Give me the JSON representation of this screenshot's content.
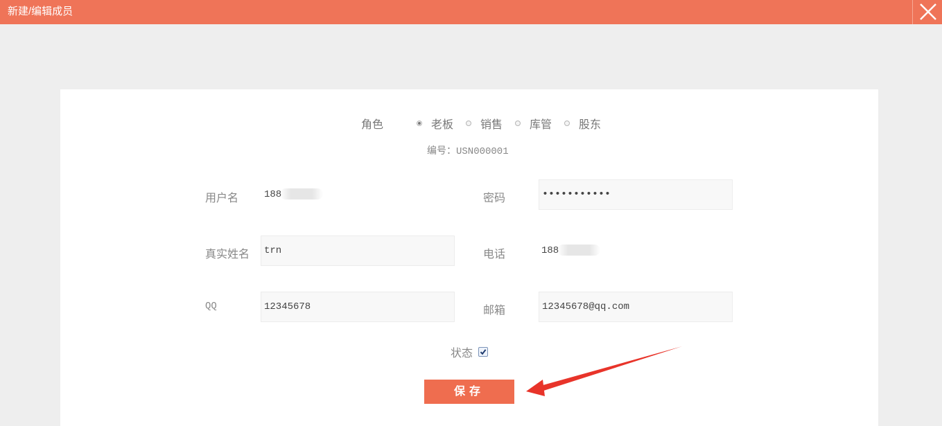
{
  "window": {
    "title": "新建/编辑成员",
    "close_icon": "close-icon"
  },
  "form": {
    "role": {
      "label": "角色",
      "options": [
        {
          "label": "老板",
          "checked": true
        },
        {
          "label": "销售",
          "checked": false
        },
        {
          "label": "库管",
          "checked": false
        },
        {
          "label": "股东",
          "checked": false
        }
      ]
    },
    "code": {
      "label": "编号：",
      "value": "USN000001"
    },
    "username": {
      "label": "用户名",
      "value": "188"
    },
    "password": {
      "label": "密码",
      "value": "•••••••••••"
    },
    "realname": {
      "label": "真实姓名",
      "value": "trn"
    },
    "phone": {
      "label": "电话",
      "value": "188"
    },
    "qq": {
      "label": "QQ",
      "value": "12345678"
    },
    "email": {
      "label": "邮箱",
      "value": "12345678@qq.com"
    },
    "status": {
      "label": "状态",
      "checked": true
    },
    "save_label": "保存"
  },
  "colors": {
    "accent": "#ef7458",
    "button": "#ef6d4f",
    "annotation_arrow": "#e8342a"
  }
}
